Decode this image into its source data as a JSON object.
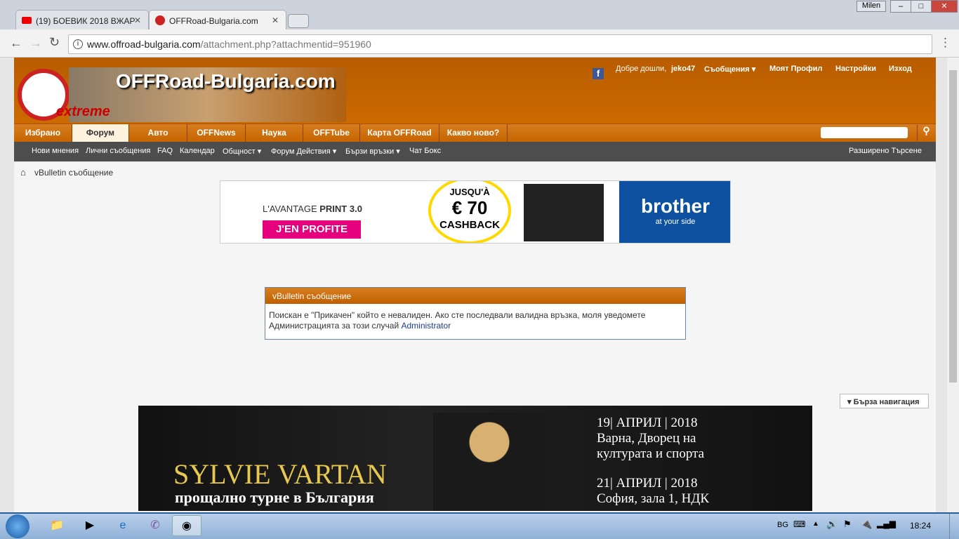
{
  "browser": {
    "tabs": [
      {
        "title": "(19) БОЕВИК 2018 ВЖАР"
      },
      {
        "title": "OFFRoad-Bulgaria.com"
      }
    ],
    "user": "Milen",
    "url_host": "www.offroad-bulgaria.com",
    "url_path": "/attachment.php?attachmentid=951960"
  },
  "site": {
    "logo": "OFFRoad-Bulgaria.com",
    "logo_sub": "extreme",
    "header_links": {
      "welcome": "Добре дошли,",
      "username": "jeko47",
      "messages": "Съобщения",
      "profile": "Моят Профил",
      "settings": "Настройки",
      "logout": "Изход"
    },
    "nav": [
      "Избрано",
      "Форум",
      "Авто",
      "OFFNews",
      "Наука",
      "OFFTube",
      "Карта OFFRoad",
      "Какво ново?"
    ],
    "subnav": [
      "Нови мнения",
      "Лични съобщения",
      "FAQ",
      "Календар",
      "Общност",
      "Форум Действия",
      "Бързи връзки",
      "Чат Бокс"
    ],
    "advanced_search": "Разширено Търсене",
    "breadcrumb": "vBulletin съобщение"
  },
  "ad1": {
    "line1": "L'AVANTAGE",
    "line1b": "PRINT 3.0",
    "cta": "J'EN PROFITE",
    "circle1": "JUSQU'À",
    "circle2": "€ 70",
    "circle3": "CASHBACK",
    "brand": "brother",
    "tagline": "at your side"
  },
  "message": {
    "title": "vBulletin съобщение",
    "body": "Поискан е \"Прикачен\" който е невалиден. Ако сте последвали валидна връзка, моля уведомете Администрацията за този случай",
    "link": "Administrator"
  },
  "quick_nav": "Бърза навигация",
  "ad2": {
    "name": "SYLVIE VARTAN",
    "subtitle": "прощално турне в България",
    "date1": "19| АПРИЛ | 2018",
    "place1a": "Варна, Дворец на",
    "place1b": "културата и спорта",
    "date2": "21| АПРИЛ | 2018",
    "place2": "София, зала 1, НДК"
  },
  "taskbar": {
    "lang": "BG",
    "time": "18:24"
  }
}
